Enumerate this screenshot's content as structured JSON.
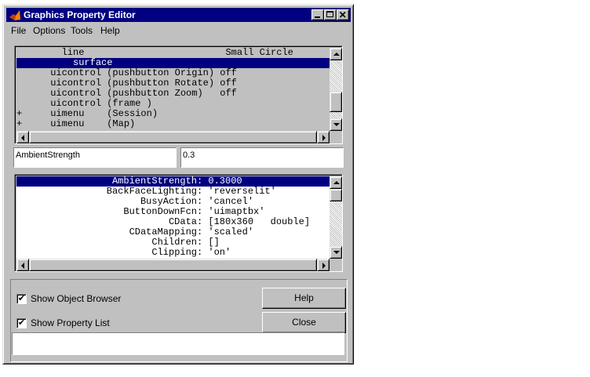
{
  "window": {
    "title": "Graphics Property Editor"
  },
  "menu": [
    "File",
    "Options",
    "Tools",
    "Help"
  ],
  "object_browser": {
    "rows": [
      {
        "text": "        line                         Small Circle",
        "selected": false
      },
      {
        "text": "          surface",
        "selected": true
      },
      {
        "text": "      uicontrol (pushbutton Origin) off",
        "selected": false
      },
      {
        "text": "      uicontrol (pushbutton Rotate) off",
        "selected": false
      },
      {
        "text": "      uicontrol (pushbutton Zoom)   off",
        "selected": false
      },
      {
        "text": "      uicontrol (frame )",
        "selected": false
      },
      {
        "text": "+     uimenu    (Session)",
        "selected": false
      },
      {
        "text": "+     uimenu    (Map)",
        "selected": false
      }
    ]
  },
  "property_name": "AmbientStrength",
  "property_value": "0.3",
  "property_list": {
    "rows": [
      {
        "name": "AmbientStrength",
        "value": "0.3000",
        "selected": true
      },
      {
        "name": "BackFaceLighting",
        "value": "'reverselit'",
        "selected": false
      },
      {
        "name": "BusyAction",
        "value": "'cancel'",
        "selected": false
      },
      {
        "name": "ButtonDownFcn",
        "value": "'uimaptbx'",
        "selected": false
      },
      {
        "name": "CData",
        "value": "[180x360   double]",
        "selected": false
      },
      {
        "name": "CDataMapping",
        "value": "'scaled'",
        "selected": false
      },
      {
        "name": "Children",
        "value": "[]",
        "selected": false
      },
      {
        "name": "Clipping",
        "value": "'on'",
        "selected": false
      }
    ]
  },
  "options": {
    "show_object_browser": "Show Object Browser",
    "show_property_list": "Show Property List",
    "object_browser_checked": true,
    "property_list_checked": true
  },
  "buttons": {
    "help": "Help",
    "close": "Close"
  },
  "check_glyph": "✔",
  "colors": {
    "selection": "#000080",
    "face": "#c0c0c0"
  }
}
